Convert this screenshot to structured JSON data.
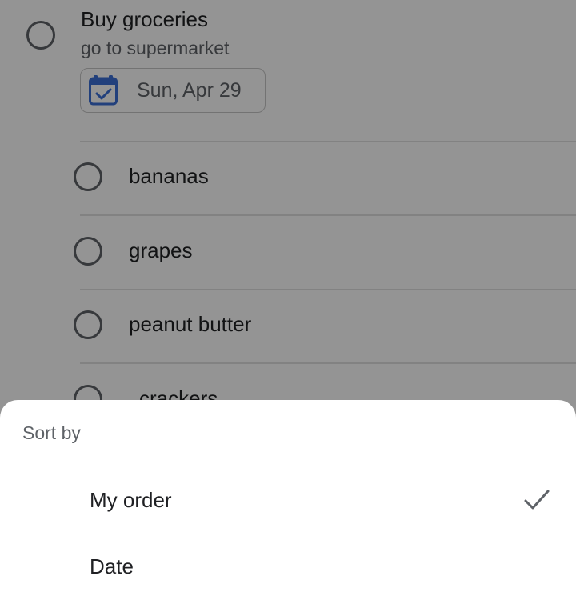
{
  "task": {
    "title": "Buy groceries",
    "note": "go to supermarket",
    "date": "Sun, Apr 29"
  },
  "subtasks": [
    {
      "label": "bananas"
    },
    {
      "label": "grapes"
    },
    {
      "label": "peanut butter"
    },
    {
      "label": "crackers"
    }
  ],
  "sort_sheet": {
    "title": "Sort by",
    "options": [
      {
        "label": "My order",
        "selected": true
      },
      {
        "label": "Date",
        "selected": false
      }
    ]
  },
  "colors": {
    "accent": "#3c6fd6",
    "scrim": "rgba(0,0,0,0.42)"
  },
  "icons": {
    "date_chip": "calendar-icon",
    "selected_option": "check-icon",
    "task_toggle": "circle-icon"
  }
}
